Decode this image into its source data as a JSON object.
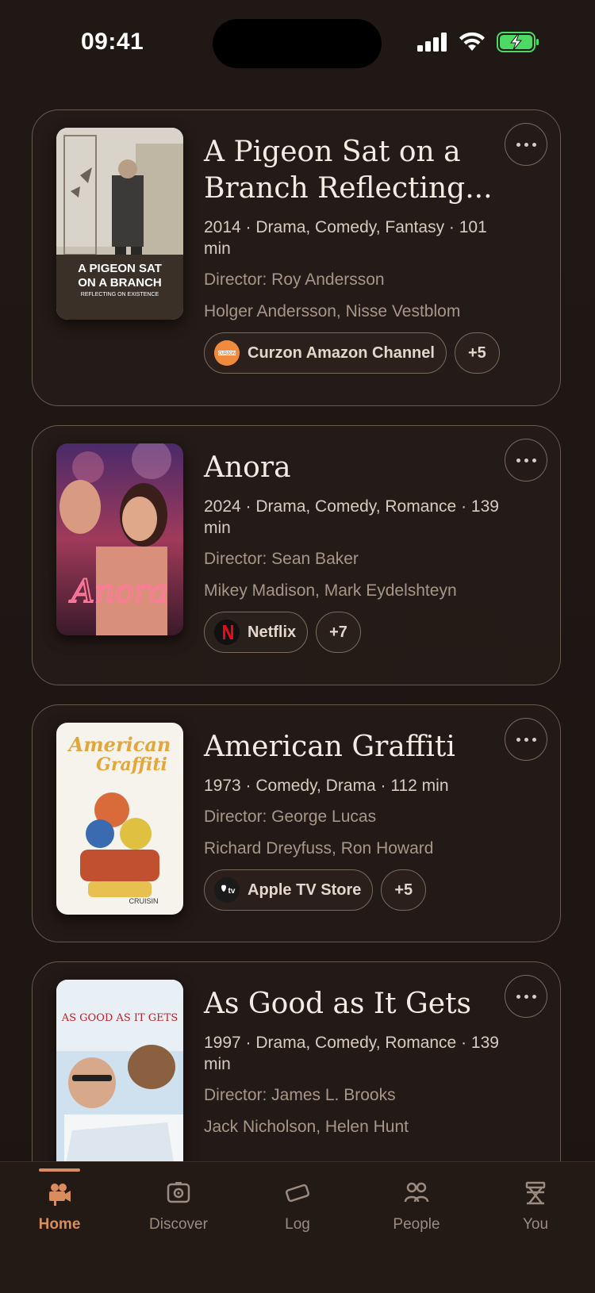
{
  "status_bar": {
    "time": "09:41"
  },
  "movies": [
    {
      "title": "A Pigeon Sat on a Branch Reflecting...",
      "meta": "2014 · Drama, Comedy, Fantasy · 101 min",
      "director": "Director: Roy Andersson",
      "cast": "Holger Andersson, Nisse Vestblom",
      "poster_text": "A PIGEON SAT ON A BRANCH",
      "poster_subtext": "REFLECTING ON EXISTENCE",
      "provider": "Curzon Amazon Channel",
      "provider_logo_text": "CURZON",
      "more": "+5"
    },
    {
      "title": "Anora",
      "meta": "2024 · Drama, Comedy, Romance · 139 min",
      "director": "Director: Sean Baker",
      "cast": "Mikey Madison, Mark Eydelshteyn",
      "poster_text": "Anora",
      "provider": "Netflix",
      "provider_logo_text": "N",
      "more": "+7"
    },
    {
      "title": "American Graffiti",
      "meta": "1973 · Comedy, Drama · 112 min",
      "director": "Director: George Lucas",
      "cast": "Richard Dreyfuss, Ron Howard",
      "poster_text": "American Graffiti",
      "provider": "Apple TV Store",
      "provider_logo_text": "tv",
      "more": "+5"
    },
    {
      "title": "As Good as It Gets",
      "meta": "1997 · Drama, Comedy, Romance · 139 min",
      "director": "Director: James L. Brooks",
      "cast": "Jack Nicholson, Helen Hunt",
      "poster_text": "AS GOOD AS IT GETS"
    }
  ],
  "tabs": [
    {
      "label": "Home",
      "icon": "camera-icon",
      "active": true
    },
    {
      "label": "Discover",
      "icon": "discover-icon"
    },
    {
      "label": "Log",
      "icon": "ticket-icon"
    },
    {
      "label": "People",
      "icon": "people-icon"
    },
    {
      "label": "You",
      "icon": "director-chair-icon"
    }
  ],
  "colors": {
    "background": "#1e1613",
    "accent": "#d98c5f",
    "card_border": "#6a5a4e",
    "battery_green": "#4cd964"
  }
}
